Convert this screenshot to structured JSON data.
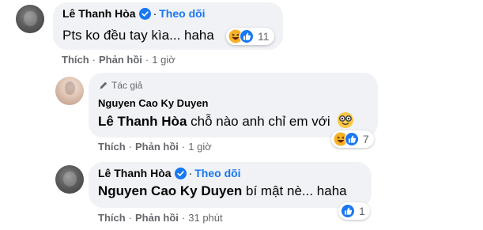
{
  "comments": [
    {
      "author": "Lê Thanh Hòa",
      "follow_label": "Theo dõi",
      "dot": "·",
      "text": "Pts ko đều tay kìa... haha",
      "reaction_count": "11",
      "reactions": [
        "haha-icon",
        "like-icon"
      ],
      "actions": {
        "like": "Thích",
        "reply": "Phản hồi",
        "time": "1 giờ"
      }
    },
    {
      "author_badge": "Tác giả",
      "author": "Nguyen Cao Ky Duyen",
      "mention": "Lê Thanh Hòa",
      "text": " chỗ nào anh chỉ em với",
      "reaction_count": "7",
      "reactions": [
        "haha-icon",
        "like-icon"
      ],
      "actions": {
        "like": "Thích",
        "reply": "Phản hồi",
        "time": "1 giờ"
      }
    },
    {
      "author": "Lê Thanh Hòa",
      "follow_label": "Theo dõi",
      "dot": "·",
      "mention": "Nguyen Cao Ky Duyen",
      "text": " bí mật nè... haha",
      "reaction_count": "1",
      "reactions": [
        "like-icon"
      ],
      "actions": {
        "like": "Thích",
        "reply": "Phản hồi",
        "time": "31 phút"
      }
    }
  ],
  "separator": "·",
  "colors": {
    "bubble": "#f0f2f5",
    "link": "#1877f2",
    "secondary_text": "#65676b",
    "like_blue": "#1877f2",
    "haha_yellow": "#f7b125"
  }
}
